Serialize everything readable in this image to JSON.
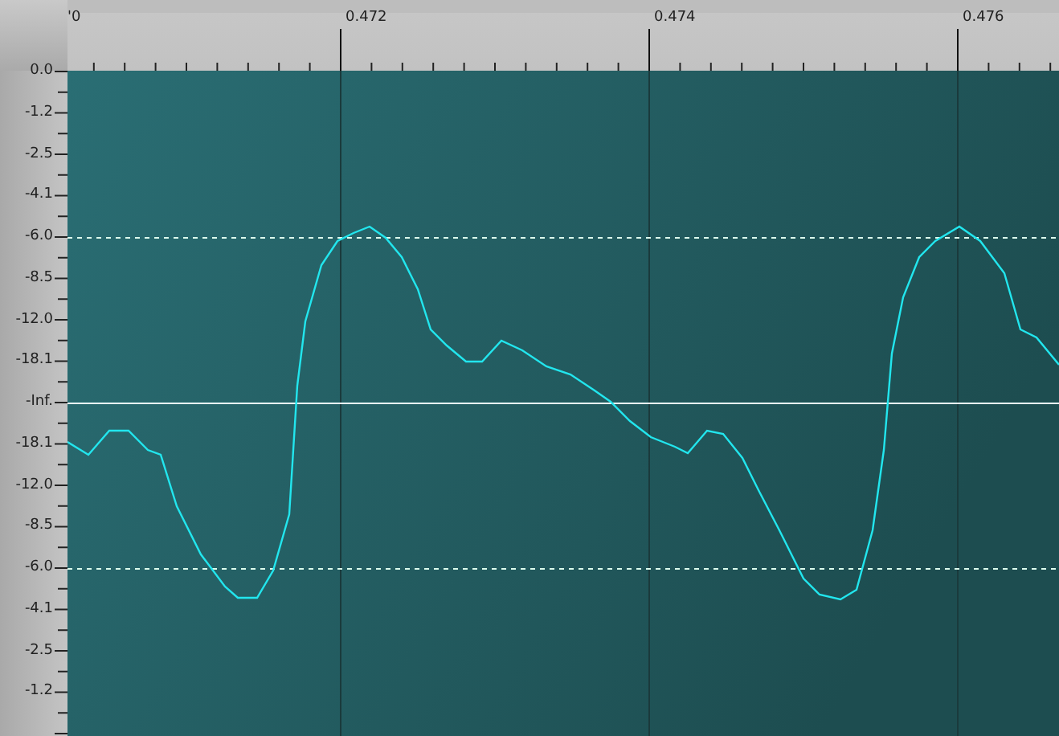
{
  "time_ruler": {
    "labels": [
      "'0",
      "0.472",
      "0.474",
      "0.476"
    ]
  },
  "level_scale": {
    "labels": [
      "0.0",
      "-1.2",
      "-2.5",
      "-4.1",
      "-6.0",
      "-8.5",
      "-12.0",
      "-18.1",
      "-Inf.",
      "-18.1",
      "-12.0",
      "-8.5",
      "-6.0",
      "-4.1",
      "-2.5",
      "-1.2"
    ]
  }
}
